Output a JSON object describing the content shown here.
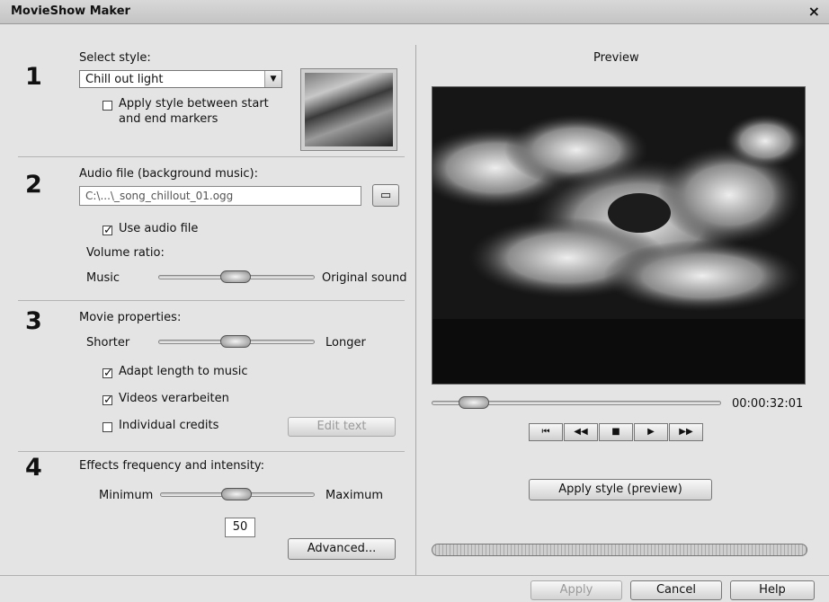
{
  "window": {
    "title": "MovieShow Maker",
    "close_glyph": "×"
  },
  "style_section": {
    "number": "1",
    "label": "Select style:",
    "selected": "Chill out light",
    "apply_markers_label_1": "Apply style between start",
    "apply_markers_label_2": "and end markers",
    "apply_markers_checked": false
  },
  "audio_section": {
    "number": "2",
    "label": "Audio file (background music):",
    "path": "C:\\...\\_song_chillout_01.ogg",
    "use_audio_label": "Use audio file",
    "use_audio_checked": true,
    "volume_label": "Volume ratio:",
    "music_label": "Music",
    "original_label": "Original sound",
    "volume_ratio": 0.5
  },
  "movie_section": {
    "number": "3",
    "label": "Movie properties:",
    "shorter_label": "Shorter",
    "longer_label": "Longer",
    "length_value": 0.5,
    "adapt_label": "Adapt length to music",
    "adapt_checked": true,
    "videos_label": "Videos verarbeiten",
    "videos_checked": true,
    "credits_label": "Individual credits",
    "credits_checked": false,
    "edit_text_label": "Edit text"
  },
  "effects_section": {
    "number": "4",
    "label": "Effects frequency and intensity:",
    "min_label": "Minimum",
    "max_label": "Maximum",
    "value": "50",
    "advanced_label": "Advanced..."
  },
  "preview": {
    "label": "Preview",
    "time": "00:00:32:01",
    "apply_style_label": "Apply style (preview)",
    "transport_icons": [
      "skip-to-start-icon",
      "rewind-icon",
      "stop-icon",
      "play-icon",
      "fast-forward-icon"
    ]
  },
  "footer": {
    "apply_label": "Apply",
    "cancel_label": "Cancel",
    "help_label": "Help"
  }
}
